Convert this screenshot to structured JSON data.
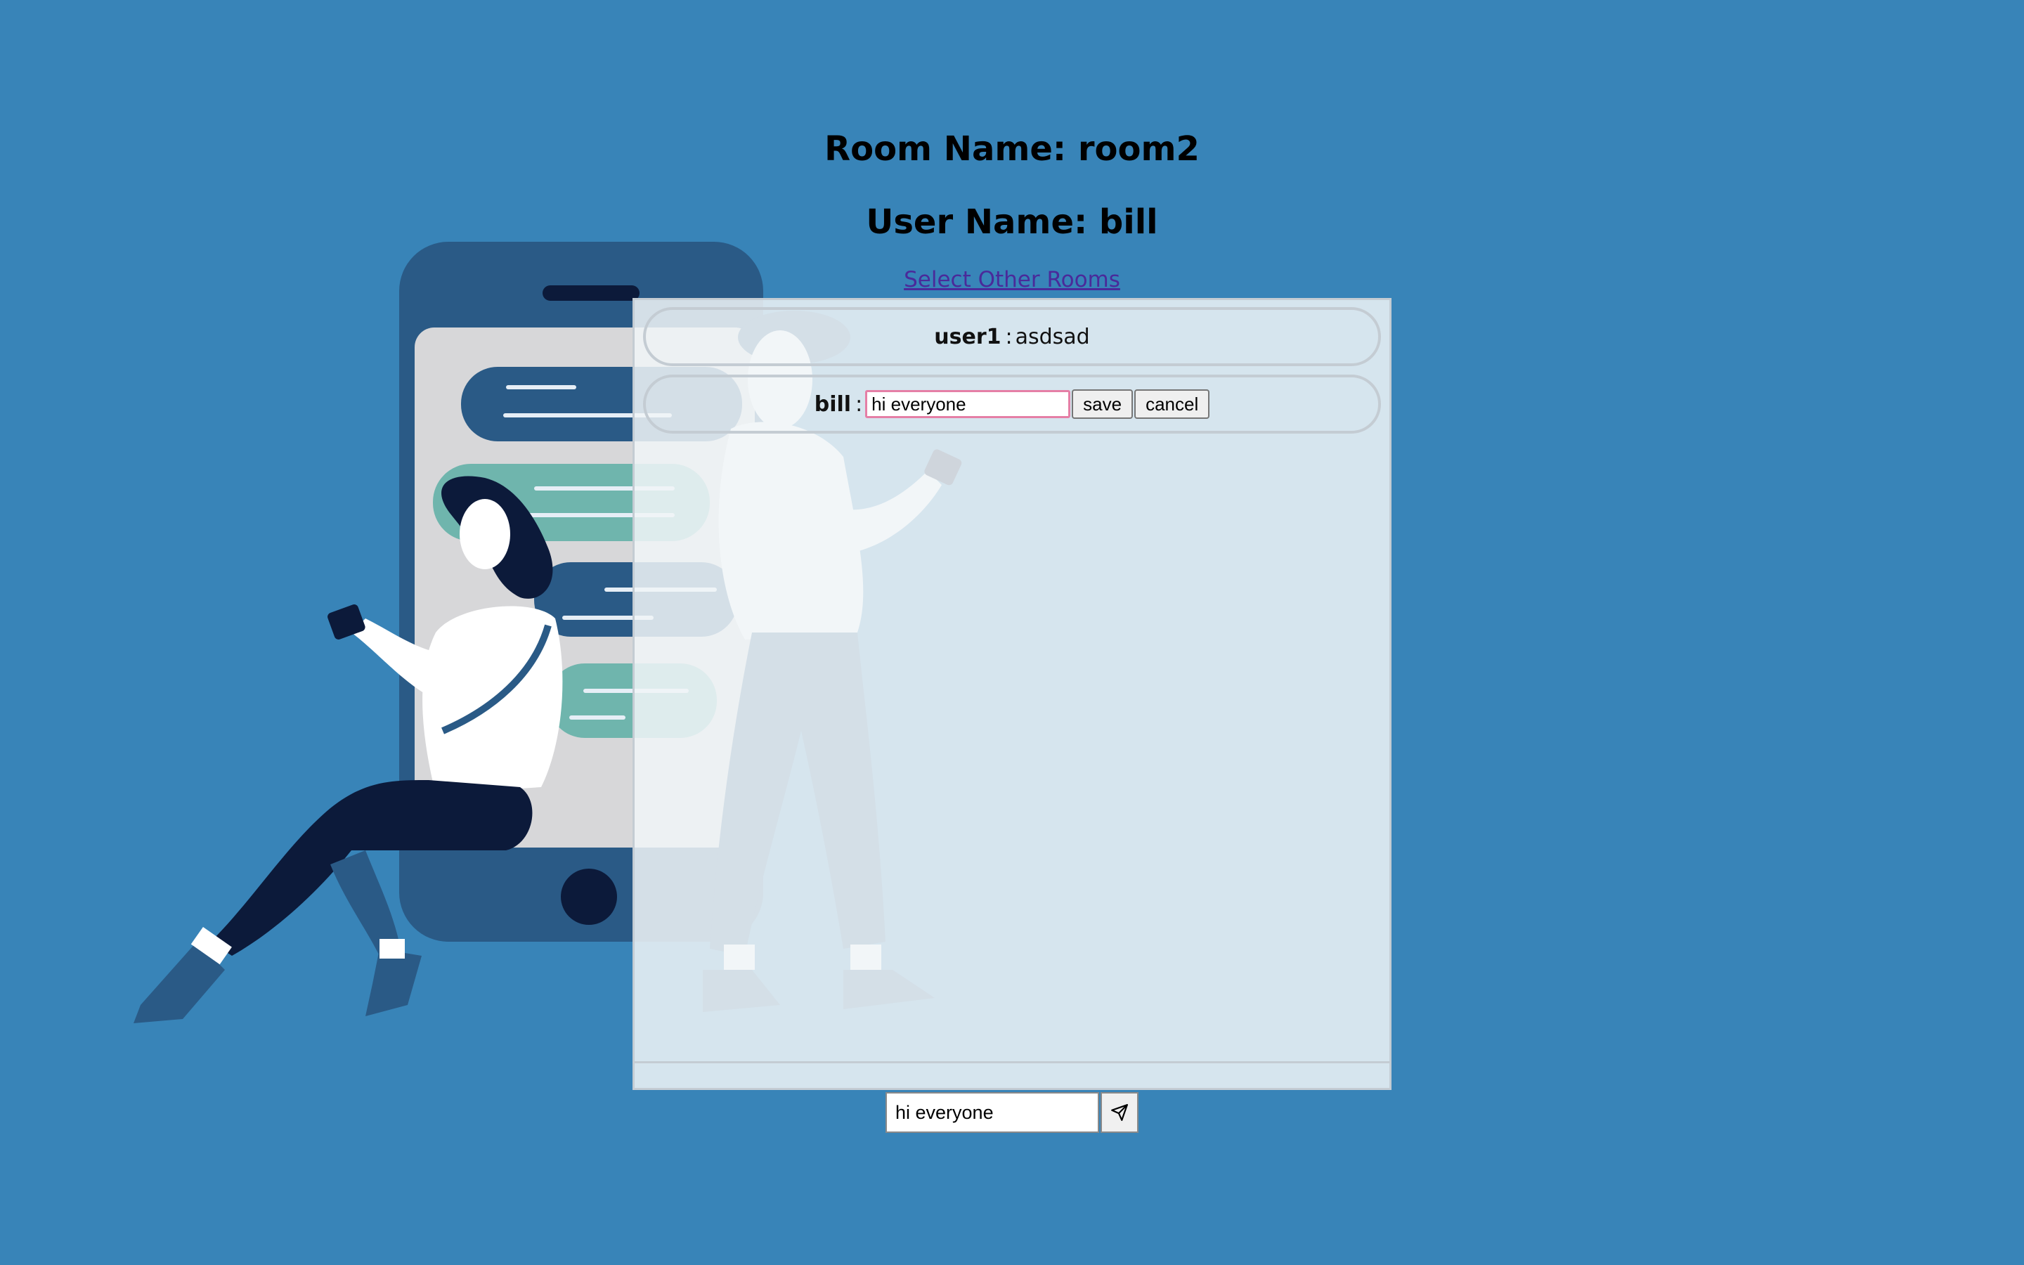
{
  "header": {
    "room_title": "Room Name: room2",
    "user_title": "User Name: bill",
    "select_rooms_link": "Select Other Rooms"
  },
  "messages": [
    {
      "author": "user1",
      "separator": ":",
      "text": "asdsad"
    },
    {
      "author": "bill",
      "separator": ":",
      "edit_value": "hi everyone",
      "save_label": "save",
      "cancel_label": "cancel"
    }
  ],
  "composer": {
    "value": "hi everyone",
    "send_icon": "send-icon"
  },
  "colors": {
    "background": "#3884b8",
    "phone": "#2a5a86",
    "dark_navy": "#0c1a3a",
    "teal_bubble": "#6fb5ad",
    "panel": "#f0f4f7",
    "edit_border": "#e57fa6"
  }
}
